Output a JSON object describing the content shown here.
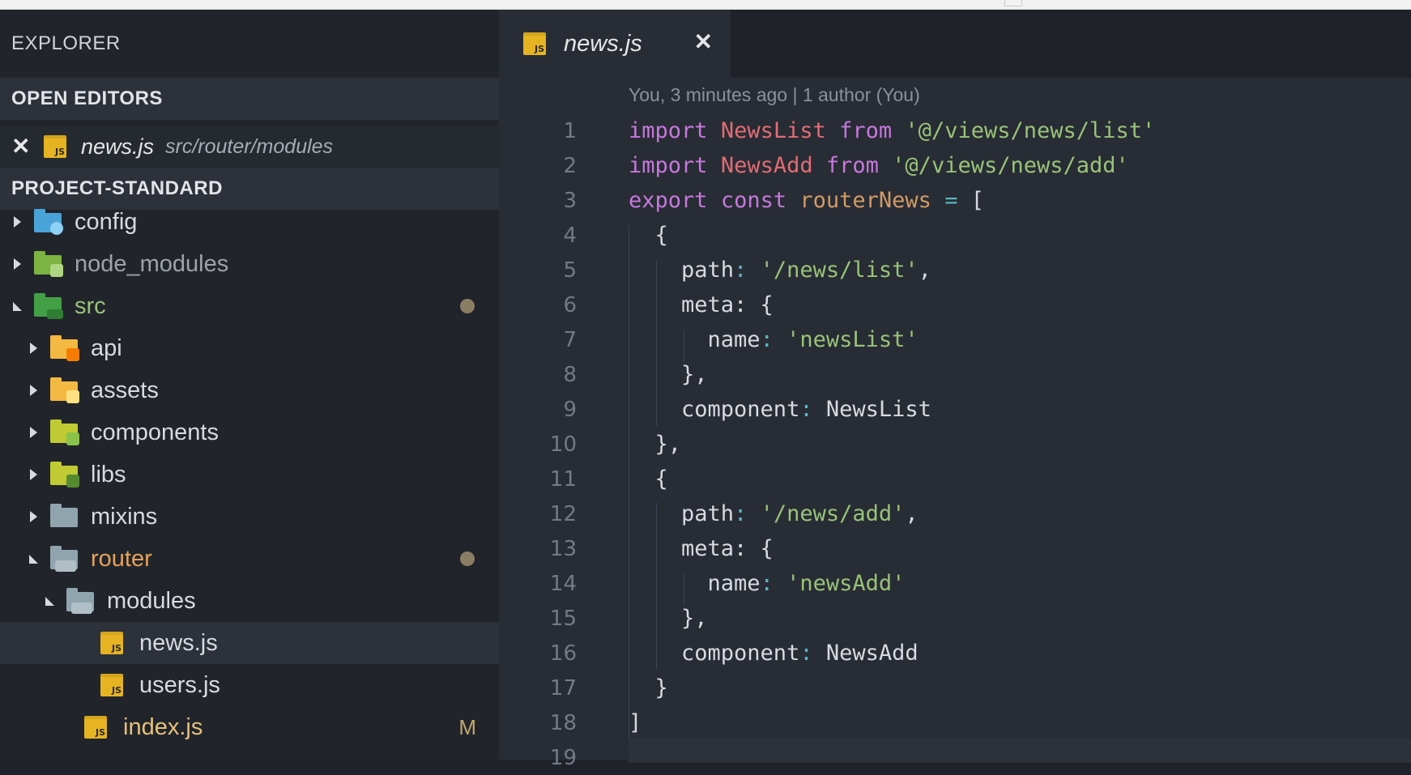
{
  "sidebar": {
    "title": "EXPLORER",
    "open_editors": {
      "header": "OPEN EDITORS",
      "items": [
        {
          "name": "news.js",
          "path": "src/router/modules"
        }
      ]
    },
    "project": {
      "header": "PROJECT-STANDARD",
      "tree": [
        {
          "label": "config",
          "depth": 0,
          "expanded": false,
          "icon": "folder-config-icon",
          "color": "#4aa3d8"
        },
        {
          "label": "node_modules",
          "depth": 0,
          "expanded": false,
          "icon": "folder-node-icon",
          "color": "#8bc34a"
        },
        {
          "label": "src",
          "depth": 0,
          "expanded": true,
          "icon": "folder-src-icon",
          "color": "#4caf50"
        },
        {
          "label": "api",
          "depth": 1,
          "expanded": false,
          "icon": "folder-api-icon",
          "color": "#f4b942"
        },
        {
          "label": "assets",
          "depth": 1,
          "expanded": false,
          "icon": "folder-assets-icon",
          "color": "#f4b942"
        },
        {
          "label": "components",
          "depth": 1,
          "expanded": false,
          "icon": "folder-components-icon",
          "color": "#c0ca33"
        },
        {
          "label": "libs",
          "depth": 1,
          "expanded": false,
          "icon": "folder-libs-icon",
          "color": "#c0ca33"
        },
        {
          "label": "mixins",
          "depth": 1,
          "expanded": false,
          "icon": "folder-icon",
          "color": "#90a4ae"
        },
        {
          "label": "router",
          "depth": 1,
          "expanded": true,
          "icon": "folder-router-icon",
          "color": "#90a4ae"
        },
        {
          "label": "modules",
          "depth": 2,
          "expanded": true,
          "icon": "folder-open-icon",
          "color": "#90a4ae"
        },
        {
          "label": "news.js",
          "depth": 3,
          "file": true,
          "icon": "js-file-icon"
        },
        {
          "label": "users.js",
          "depth": 3,
          "file": true,
          "icon": "js-file-icon"
        },
        {
          "label": "index.js",
          "depth": 2,
          "file": true,
          "icon": "js-file-icon",
          "badge": "M"
        }
      ]
    }
  },
  "editor": {
    "tab": {
      "label": "news.js"
    },
    "blame": "You, 3 minutes ago | 1 author (You)",
    "line_numbers": [
      "1",
      "2",
      "3",
      "4",
      "5",
      "6",
      "7",
      "8",
      "9",
      "10",
      "11",
      "12",
      "13",
      "14",
      "15",
      "16",
      "17",
      "18",
      "19"
    ],
    "code": {
      "l1": [
        "import",
        " ",
        "NewsList",
        " ",
        "from",
        " ",
        "'@/views/news/list'"
      ],
      "l2": [
        "import",
        " ",
        "NewsAdd",
        " ",
        "from",
        " ",
        "'@/views/news/add'"
      ],
      "l3": [
        "export",
        " ",
        "const",
        " ",
        "routerNews",
        " ",
        "=",
        " ["
      ],
      "l4": "  {",
      "l5": [
        "    path",
        ": ",
        "'/news/list'",
        ","
      ],
      "l6": [
        "    meta",
        ": {"
      ],
      "l7": [
        "      name",
        ": ",
        "'newsList'"
      ],
      "l8": "    },",
      "l9": [
        "    component",
        ": ",
        "NewsList"
      ],
      "l10": "  },",
      "l11": "  {",
      "l12": [
        "    path",
        ": ",
        "'/news/add'",
        ","
      ],
      "l13": [
        "    meta",
        ": {"
      ],
      "l14": [
        "      name",
        ": ",
        "'newsAdd'"
      ],
      "l15": "    },",
      "l16": [
        "    component",
        ": ",
        "NewsAdd"
      ],
      "l17": "  }",
      "l18": "]",
      "l19": ""
    }
  }
}
